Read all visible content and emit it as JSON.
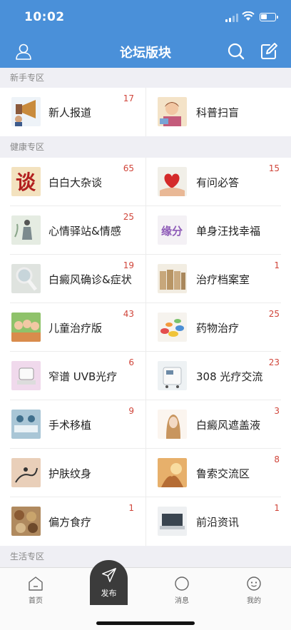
{
  "status": {
    "time": "10:02",
    "battery_level": 0.45
  },
  "header": {
    "title": "论坛版块",
    "icons": [
      "user-icon",
      "search-icon",
      "edit-icon"
    ]
  },
  "sections": [
    {
      "title": "新手专区",
      "rows": [
        [
          {
            "label": "新人报道",
            "count": "17",
            "thumb": "megaphone"
          },
          {
            "label": "科普扫盲",
            "count": "",
            "thumb": "cartoon-girl"
          }
        ]
      ]
    },
    {
      "title": "健康专区",
      "rows": [
        [
          {
            "label": "白白大杂谈",
            "count": "65",
            "thumb": "calligraphy"
          },
          {
            "label": "有问必答",
            "count": "15",
            "thumb": "heart-hands"
          }
        ],
        [
          {
            "label": "心情驿站&情感",
            "count": "25",
            "thumb": "sketch-figure"
          },
          {
            "label": "单身汪找幸福",
            "count": "",
            "thumb": "yuanfen-text"
          }
        ],
        [
          {
            "label": "白癜风确诊&症状",
            "count": "19",
            "thumb": "magnifier"
          },
          {
            "label": "治疗档案室",
            "count": "1",
            "thumb": "books"
          }
        ],
        [
          {
            "label": "儿童治疗版",
            "count": "43",
            "thumb": "children"
          },
          {
            "label": "药物治疗",
            "count": "25",
            "thumb": "pills"
          }
        ],
        [
          {
            "label": "窄谱 UVB光疗",
            "count": "6",
            "thumb": "uvb-device"
          },
          {
            "label": "308 光疗交流",
            "count": "23",
            "thumb": "laser-machine"
          }
        ],
        [
          {
            "label": "手术移植",
            "count": "9",
            "thumb": "surgery"
          },
          {
            "label": "白癜风遮盖液",
            "count": "3",
            "thumb": "woman-portrait"
          }
        ],
        [
          {
            "label": "护肤纹身",
            "count": "",
            "thumb": "tattoo"
          },
          {
            "label": "鲁索交流区",
            "count": "8",
            "thumb": "sunset-hands"
          }
        ],
        [
          {
            "label": "偏方食疗",
            "count": "1",
            "thumb": "herbs"
          },
          {
            "label": "前沿资讯",
            "count": "1",
            "thumb": "laptop"
          }
        ]
      ]
    },
    {
      "title": "生活专区",
      "rows": []
    }
  ],
  "tabbar": {
    "home": "首页",
    "publish": "发布",
    "messages": "消息",
    "me": "我的"
  },
  "colors": {
    "primary": "#4a90d9",
    "count": "#d0453a",
    "section_bg": "#efeff4",
    "publish_bg": "#3b3b3b"
  }
}
